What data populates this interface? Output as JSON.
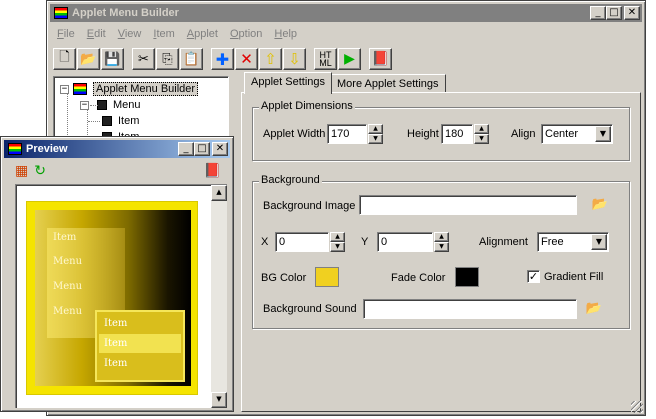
{
  "main_window": {
    "title": "Applet Menu Builder",
    "buttons": {
      "minimize": "_",
      "maximize": "□",
      "close": "✕"
    }
  },
  "menubar": [
    "File",
    "Edit",
    "View",
    "Item",
    "Applet",
    "Option",
    "Help"
  ],
  "toolbar": {
    "html_label_top": "HT",
    "html_label_bottom": "ML"
  },
  "tree": {
    "root": "Applet Menu Builder",
    "menu": "Menu",
    "items": [
      "Item",
      "Item"
    ]
  },
  "tabs": [
    "Applet Settings",
    "More Applet Settings"
  ],
  "applet_dimensions": {
    "legend": "Applet Dimensions",
    "width_label": "Applet Width",
    "width_value": "170",
    "height_label": "Height",
    "height_value": "180",
    "align_label": "Align",
    "align_value": "Center"
  },
  "background": {
    "legend": "Background",
    "image_label": "Background Image",
    "image_value": "",
    "x_label": "X",
    "x_value": "0",
    "y_label": "Y",
    "y_value": "0",
    "alignment_label": "Alignment",
    "alignment_value": "Free",
    "bg_color_label": "BG Color",
    "bg_color": "#f0d020",
    "fade_color_label": "Fade Color",
    "fade_color": "#000000",
    "gradient_fill_label": "Gradient Fill",
    "gradient_fill_checked": true,
    "sound_label": "Background Sound",
    "sound_value": ""
  },
  "preview_window": {
    "title": "Preview",
    "buttons": {
      "minimize": "_",
      "maximize": "□",
      "close": "✕"
    },
    "menu_items": [
      "Item",
      "Menu",
      "Menu",
      "Menu"
    ],
    "submenu_items": [
      "Item",
      "Item",
      "Item"
    ]
  }
}
